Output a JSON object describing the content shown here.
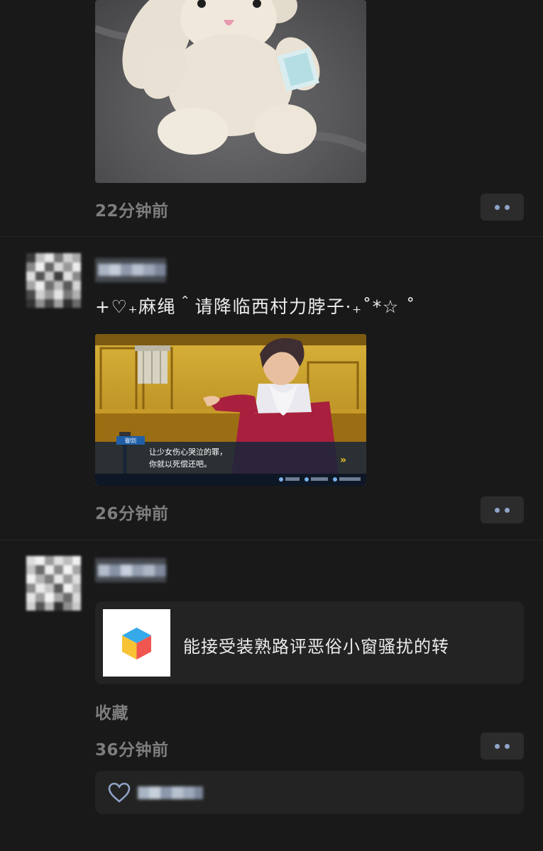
{
  "feed": {
    "posts": [
      {
        "time": "22分钟前",
        "image_desc": "plush-bunny-photo"
      },
      {
        "text": "+♡₊麻绳＾请降临西村力脖子·₊˚*☆ ˚",
        "time": "26分钟前",
        "game": {
          "speaker": "御剑",
          "dialog_line1": "让少女伤心哭泣的罪，",
          "dialog_line2": "你就以死偿还吧。"
        }
      },
      {
        "link": {
          "title": "能接受装熟路评恶俗小窗骚扰的转"
        },
        "tag": "收藏",
        "time": "36分钟前"
      }
    ]
  },
  "colors": {
    "background": "#191919",
    "card": "#232323",
    "time_text": "#7e7e7e",
    "more_dots": "#8fa3c7"
  },
  "icons": {
    "more": "more-dots-icon",
    "like": "heart-outline-icon",
    "app": "cube-app-icon"
  }
}
